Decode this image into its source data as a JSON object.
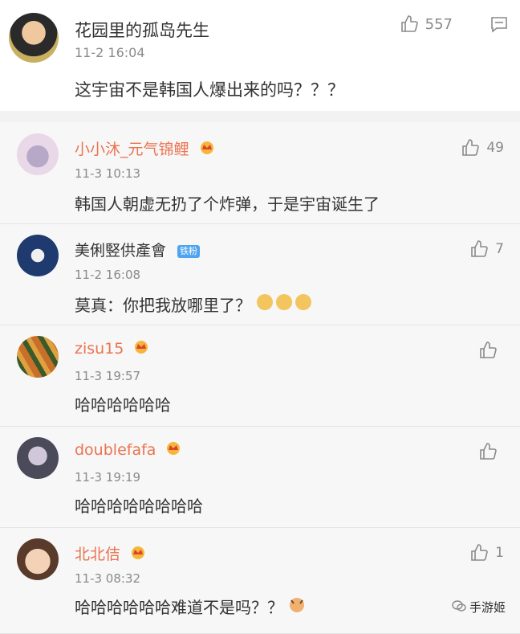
{
  "post": {
    "username": "花园里的孤岛先生",
    "time": "11-2 16:04",
    "likes": "557",
    "content": "这宇宙不是韩国人爆出来的吗？？？"
  },
  "replies": [
    {
      "username": "小小沐_元气锦鲤",
      "badge": "crown",
      "time": "11-3 10:13",
      "likes": "49",
      "content": "韩国人朝虚无扔了个炸弹，于是宇宙诞生了"
    },
    {
      "username": "美俐竪供產會",
      "badge": "铁粉",
      "time": "11-2 16:08",
      "likes": "7",
      "content": "莫真：你把我放哪里了？"
    },
    {
      "username": "zisu15",
      "badge": "crown",
      "time": "11-3 19:57",
      "likes": "",
      "content": "哈哈哈哈哈哈"
    },
    {
      "username": "doublefafa",
      "badge": "crown",
      "time": "11-3 19:19",
      "likes": "",
      "content": "哈哈哈哈哈哈哈哈"
    },
    {
      "username": "北北佶",
      "badge": "crown",
      "time": "11-3 08:32",
      "likes": "1",
      "content": "哈哈哈哈哈哈难道不是吗？？"
    }
  ],
  "watermark": "手游姬",
  "colors": {
    "name_highlight": "#eb7350",
    "gray": "#8a8a8a",
    "badge_blue": "#4fa3f0"
  },
  "icons": {
    "like": "thumbs-up-icon",
    "comment": "comment-icon",
    "crown": "vip-crown-icon",
    "emoji": "doge-emoji-icon"
  }
}
